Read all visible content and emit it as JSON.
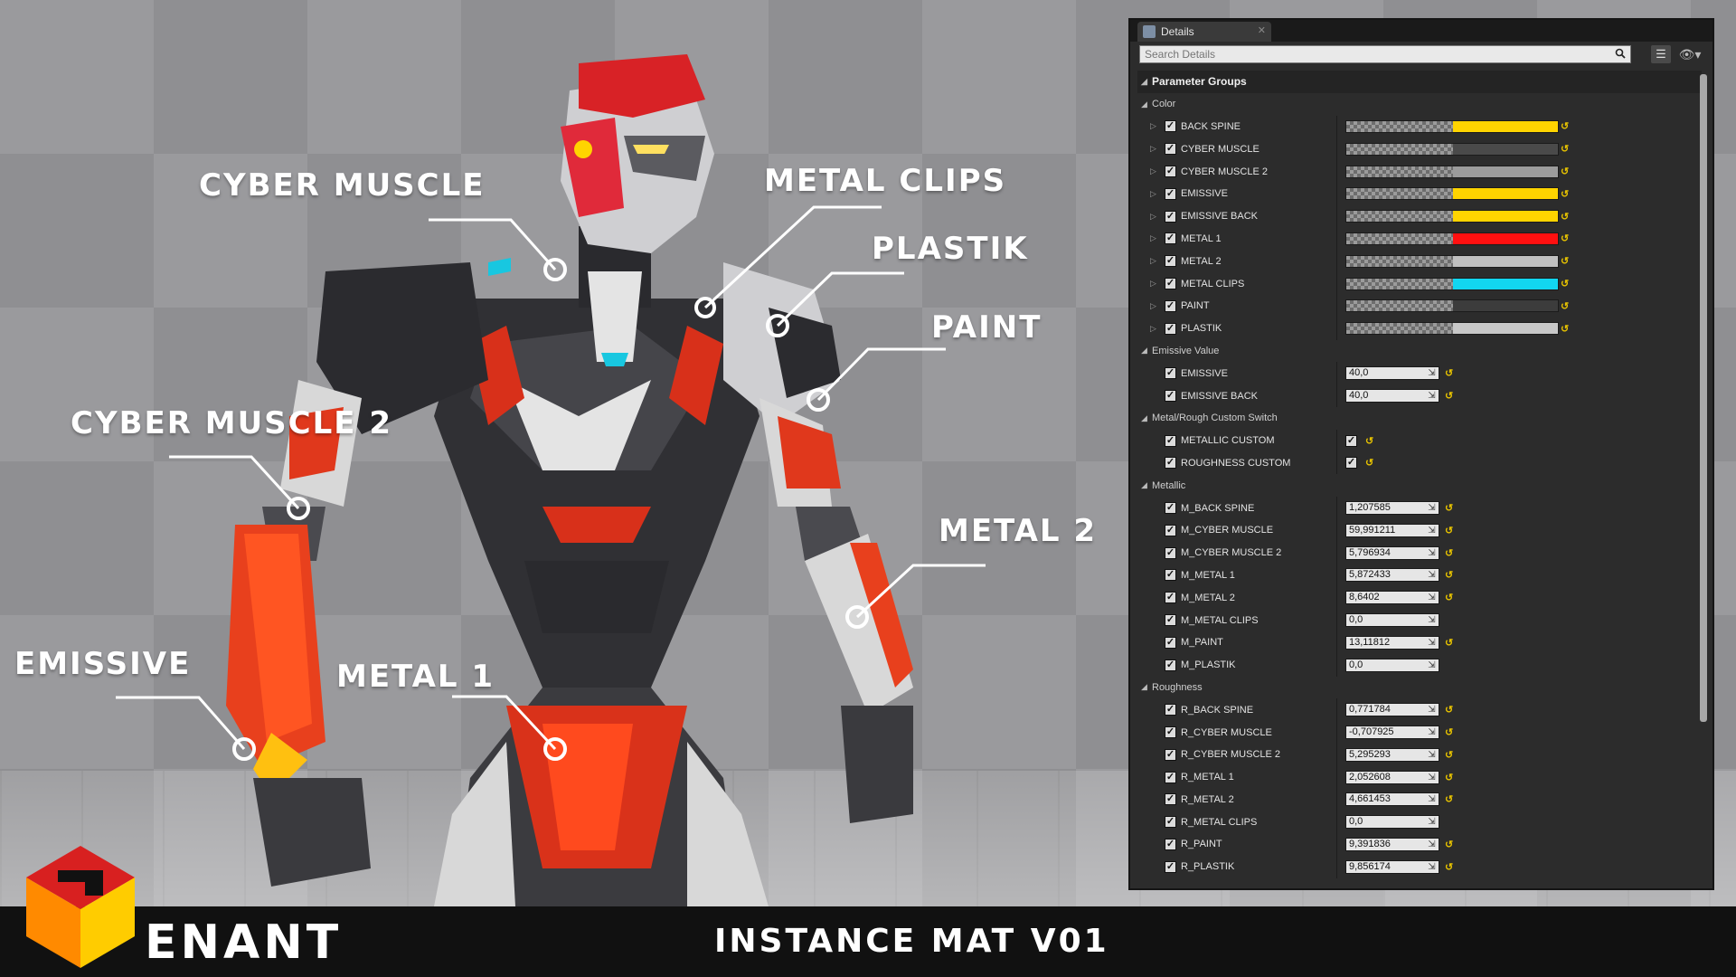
{
  "viewport": {
    "callouts": [
      {
        "id": "cyber-muscle",
        "label": "CYBER MUSCLE"
      },
      {
        "id": "metal-clips",
        "label": "METAL CLIPS"
      },
      {
        "id": "plastik",
        "label": "PLASTIK"
      },
      {
        "id": "paint",
        "label": "PAINT"
      },
      {
        "id": "cyber-muscle-2",
        "label": "CYBER MUSCLE 2"
      },
      {
        "id": "metal-2",
        "label": "METAL 2"
      },
      {
        "id": "emissive",
        "label": "EMISSIVE"
      },
      {
        "id": "metal-1",
        "label": "METAL 1"
      }
    ]
  },
  "banner": {
    "brand": "ENANT",
    "title": "INSTANCE MAT V01"
  },
  "details": {
    "tab_label": "Details",
    "search_placeholder": "Search Details",
    "groups": [
      {
        "label": "Parameter Groups",
        "kind": "top"
      },
      {
        "label": "Color",
        "kind": "group"
      },
      {
        "label": "BACK SPINE",
        "kind": "color",
        "color": "#ffd400"
      },
      {
        "label": "CYBER MUSCLE",
        "kind": "color",
        "color": "#4a4a4a"
      },
      {
        "label": "CYBER MUSCLE  2",
        "kind": "color",
        "color": "#9c9c9c"
      },
      {
        "label": "EMISSIVE",
        "kind": "color",
        "color": "#ffd400"
      },
      {
        "label": "EMISSIVE BACK",
        "kind": "color",
        "color": "#ffd400"
      },
      {
        "label": "METAL 1",
        "kind": "color",
        "color": "#ff1010"
      },
      {
        "label": "METAL 2",
        "kind": "color",
        "color": "#c0c0c0"
      },
      {
        "label": "METAL CLIPS",
        "kind": "color",
        "color": "#12d6f0"
      },
      {
        "label": "PAINT",
        "kind": "color",
        "color": "#3c3c3c"
      },
      {
        "label": "PLASTIK",
        "kind": "color",
        "color": "#c8c8c8"
      },
      {
        "label": "Emissive Value",
        "kind": "group"
      },
      {
        "label": "EMISSIVE",
        "kind": "number",
        "value": "40,0",
        "reset": true
      },
      {
        "label": "EMISSIVE  BACK",
        "kind": "number",
        "value": "40,0",
        "reset": true
      },
      {
        "label": "Metal/Rough Custom Switch",
        "kind": "group"
      },
      {
        "label": "METALLIC CUSTOM",
        "kind": "bool",
        "reset": true
      },
      {
        "label": "ROUGHNESS CUSTOM",
        "kind": "bool",
        "reset": true
      },
      {
        "label": "Metallic",
        "kind": "group"
      },
      {
        "label": "M_BACK SPINE",
        "kind": "number",
        "value": "1,207585",
        "reset": true
      },
      {
        "label": "M_CYBER MUSCLE",
        "kind": "number",
        "value": "59,991211",
        "reset": true
      },
      {
        "label": "M_CYBER MUSCLE 2",
        "kind": "number",
        "value": "5,796934",
        "reset": true
      },
      {
        "label": "M_METAL 1",
        "kind": "number",
        "value": "5,872433",
        "reset": true
      },
      {
        "label": "M_METAL 2",
        "kind": "number",
        "value": "8,6402",
        "reset": true
      },
      {
        "label": "M_METAL CLIPS",
        "kind": "number",
        "value": "0,0",
        "reset": false
      },
      {
        "label": "M_PAINT",
        "kind": "number",
        "value": "13,11812",
        "reset": true
      },
      {
        "label": "M_PLASTIK",
        "kind": "number",
        "value": "0,0",
        "reset": false
      },
      {
        "label": "Roughness",
        "kind": "group"
      },
      {
        "label": "R_BACK SPINE",
        "kind": "number",
        "value": "0,771784",
        "reset": true
      },
      {
        "label": "R_CYBER MUSCLE",
        "kind": "number",
        "value": "-0,707925",
        "reset": true
      },
      {
        "label": "R_CYBER MUSCLE 2",
        "kind": "number",
        "value": "5,295293",
        "reset": true
      },
      {
        "label": "R_METAL 1",
        "kind": "number",
        "value": "2,052608",
        "reset": true
      },
      {
        "label": "R_METAL 2",
        "kind": "number",
        "value": "4,661453",
        "reset": true
      },
      {
        "label": "R_METAL CLIPS",
        "kind": "number",
        "value": "0,0",
        "reset": false
      },
      {
        "label": "R_PAINT",
        "kind": "number",
        "value": "9,391836",
        "reset": true
      },
      {
        "label": "R_PLASTIK",
        "kind": "number",
        "value": "9,856174",
        "reset": true
      }
    ]
  }
}
